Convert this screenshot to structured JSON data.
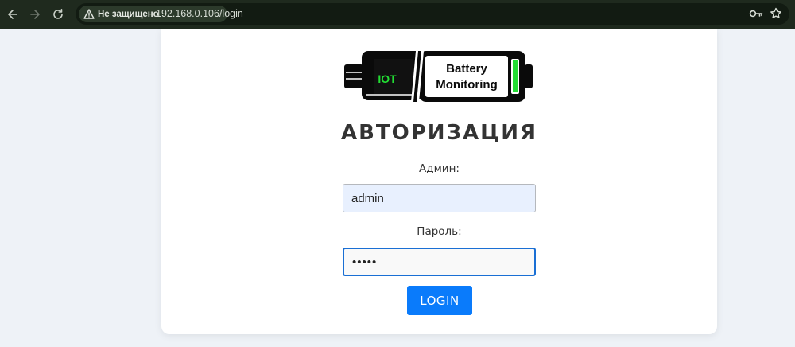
{
  "browser": {
    "security_label": "Не защищено",
    "url": "192.168.0.106/login"
  },
  "logo": {
    "left_text": "IOT",
    "line1": "Battery",
    "line2": "Monitoring"
  },
  "form": {
    "title": "АВТОРИЗАЦИЯ",
    "username_label": "Админ:",
    "username_value": "admin",
    "password_label": "Пароль:",
    "password_value": "admin",
    "submit_label": "LOGIN"
  },
  "colors": {
    "toolbar_bg": "#1f2a1e",
    "page_bg": "#eef2f7",
    "button_bg": "#0a7bfb",
    "battery_green": "#22dd33"
  }
}
